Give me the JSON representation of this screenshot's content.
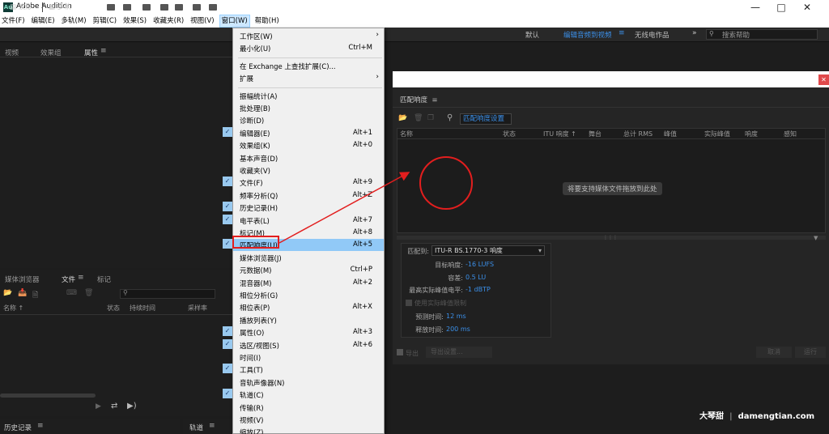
{
  "app": {
    "title": "Adobe Audition",
    "logo": "Au"
  },
  "menubar": {
    "items": [
      "文件(F)",
      "编辑(E)",
      "多轨(M)",
      "剪辑(C)",
      "效果(S)",
      "收藏夹(R)",
      "视图(V)",
      "窗口(W)",
      "帮助(H)"
    ],
    "active_index": 7
  },
  "toolbar": {
    "waveform": "波形",
    "multitrack": "多轨",
    "workspaces": {
      "default": "默认",
      "edit_video": "编辑音频到视频",
      "nowire": "无线电作品"
    },
    "search_placeholder": "搜索帮助"
  },
  "left_top": {
    "tabs": [
      "视频",
      "效果组",
      "属性"
    ],
    "active": "属性"
  },
  "left_bottom": {
    "tabs": [
      "媒体浏览器",
      "文件",
      "标记"
    ],
    "active": "文件",
    "columns": [
      "名称 ↑",
      "状态",
      "持续时间",
      "采样率"
    ]
  },
  "bottom_tabs": {
    "history": "历史记录",
    "tracks": "轨道"
  },
  "window_menu": {
    "items": [
      {
        "label": "工作区(W)",
        "arrow": true
      },
      {
        "label": "最小化(U)",
        "shortcut": "Ctrl+M"
      },
      {
        "sep": true
      },
      {
        "label": "在 Exchange 上查找扩展(C)..."
      },
      {
        "label": "扩展",
        "arrow": true
      },
      {
        "sep": true
      },
      {
        "label": "振幅统计(A)"
      },
      {
        "label": "批处理(B)"
      },
      {
        "label": "诊断(D)"
      },
      {
        "label": "编辑器(E)",
        "shortcut": "Alt+1",
        "checked": true
      },
      {
        "label": "效果组(K)",
        "shortcut": "Alt+0"
      },
      {
        "label": "基本声音(D)"
      },
      {
        "label": "收藏夹(V)"
      },
      {
        "label": "文件(F)",
        "shortcut": "Alt+9",
        "checked": true
      },
      {
        "label": "频率分析(Q)",
        "shortcut": "Alt+Z"
      },
      {
        "label": "历史记录(H)",
        "checked": true
      },
      {
        "label": "电平表(L)",
        "shortcut": "Alt+7",
        "checked": true
      },
      {
        "label": "标记(M)",
        "shortcut": "Alt+8"
      },
      {
        "label": "匹配响度(U)",
        "shortcut": "Alt+5",
        "checked": true,
        "highlighted": true
      },
      {
        "label": "媒体浏览器(J)"
      },
      {
        "label": "元数据(M)",
        "shortcut": "Ctrl+P"
      },
      {
        "label": "混音器(M)",
        "shortcut": "Alt+2"
      },
      {
        "label": "相位分析(G)"
      },
      {
        "label": "相位表(P)",
        "shortcut": "Alt+X"
      },
      {
        "label": "播放列表(Y)"
      },
      {
        "label": "属性(O)",
        "shortcut": "Alt+3",
        "checked": true
      },
      {
        "label": "选区/视图(S)",
        "shortcut": "Alt+6",
        "checked": true
      },
      {
        "label": "时间(I)"
      },
      {
        "label": "工具(T)",
        "checked": true
      },
      {
        "label": "音轨声像器(N)"
      },
      {
        "label": "轨道(C)",
        "checked": true
      },
      {
        "label": "传输(R)"
      },
      {
        "label": "视频(V)"
      },
      {
        "label": "缩放(Z)"
      }
    ]
  },
  "match_loudness": {
    "title": "匹配响度",
    "settings_btn": "匹配响度设置",
    "columns": [
      "名称",
      "状态",
      "ITU 响度 ↑",
      "舞台",
      "总计 RMS",
      "峰值",
      "实际峰值",
      "响度",
      "感知"
    ],
    "drop_msg": "将要支持媒体文件拖放到此处",
    "match_to_label": "匹配到:",
    "match_to_value": "ITU-R BS.1770-3 响度",
    "rows": [
      {
        "label": "目标响度:",
        "value": "-16 LUFS"
      },
      {
        "label": "容差:",
        "value": "0.5 LU"
      },
      {
        "label": "最高实际峰值电平:",
        "value": "-1 dBTP"
      }
    ],
    "limiter_label": "使用实际峰值限制",
    "lookahead": {
      "label": "预测时间:",
      "value": "12 ms"
    },
    "release": {
      "label": "释放时间:",
      "value": "200 ms"
    },
    "export_label": "导出",
    "export_settings": "导出设置...",
    "cancel": "取消",
    "run": "运行"
  },
  "watermark": {
    "brand": "大琴甜",
    "sep": "|",
    "url": "damengtian.com"
  }
}
